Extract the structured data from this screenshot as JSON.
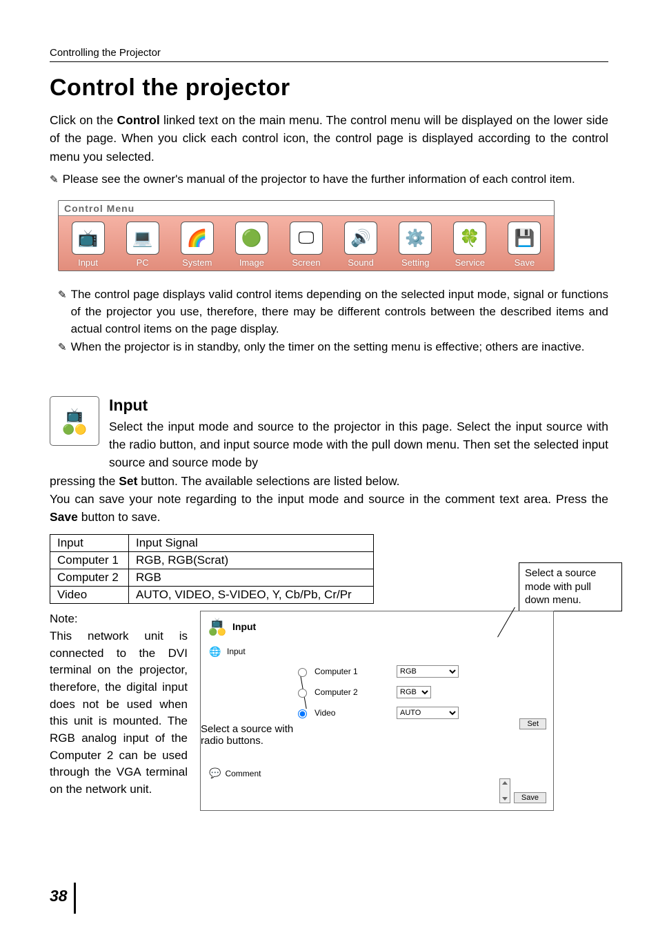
{
  "header": "Controlling the Projector",
  "title": "Control the projector",
  "intro": "Click on the Control linked text on the main menu. The control menu will be displayed on the lower side of the page. When you click each control icon, the control page is displayed according to the control menu you selected.",
  "pencil_notes_top": [
    "Please see the owner's manual of the projector to have the further information of each control item."
  ],
  "control_menu": {
    "label": "Control Menu",
    "items": [
      {
        "label": "Input",
        "glyph": "📺"
      },
      {
        "label": "PC",
        "glyph": "💻"
      },
      {
        "label": "System",
        "glyph": "🌈"
      },
      {
        "label": "Image",
        "glyph": "🟢"
      },
      {
        "label": "Screen",
        "glyph": "🖵"
      },
      {
        "label": "Sound",
        "glyph": "🔊"
      },
      {
        "label": "Setting",
        "glyph": "⚙️"
      },
      {
        "label": "Service",
        "glyph": "🍀"
      },
      {
        "label": "Save",
        "glyph": "💾"
      }
    ]
  },
  "pencil_notes_mid": [
    "The control page displays valid control items depending on the selected input mode, signal or functions of the projector you use, therefore, there may be different controls between the described items and actual control items on the page display.",
    "When the projector is in standby, only the timer on the setting menu is effective; others are inactive."
  ],
  "input_section": {
    "heading": "Input",
    "body1": "Select the input mode and source to the projector in this page. Select the input source with the radio button, and input source mode with the pull down menu. Then set the selected input source and source mode by pressing the Set button. The available selections are listed below.",
    "body2": "You can save your note regarding to the input mode and source in the comment text area. Press the Save button to save."
  },
  "table": {
    "header": [
      "Input",
      "Input Signal"
    ],
    "rows": [
      [
        "Computer 1",
        "RGB, RGB(Scrat)"
      ],
      [
        "Computer 2",
        "RGB"
      ],
      [
        "Video",
        "AUTO, VIDEO, S-VIDEO, Y, Cb/Pb, Cr/Pr"
      ]
    ]
  },
  "note_column": "Note:\nThis network unit is connected to the DVI terminal on the projector, therefore, the digital input does not be used when this unit is mounted. The RGB analog input of the Computer 2 can be used through the VGA terminal on the network unit.",
  "screenshot": {
    "title": "Input",
    "input_label": "Input",
    "radios": [
      {
        "label": "Computer 1",
        "dropdown": "RGB",
        "dd_class": "dd-wide",
        "checked": false
      },
      {
        "label": "Computer 2",
        "dropdown": "RGB",
        "dd_class": "dd-narrow",
        "checked": false
      },
      {
        "label": "Video",
        "dropdown": "AUTO",
        "dd_class": "dd-wide",
        "checked": true
      }
    ],
    "set_btn": "Set",
    "comment_label": "Comment",
    "save_btn": "Save"
  },
  "callouts": {
    "pulldown": "Select a source mode with pull down menu.",
    "radio": "Select a source with radio buttons."
  },
  "page_number": "38"
}
